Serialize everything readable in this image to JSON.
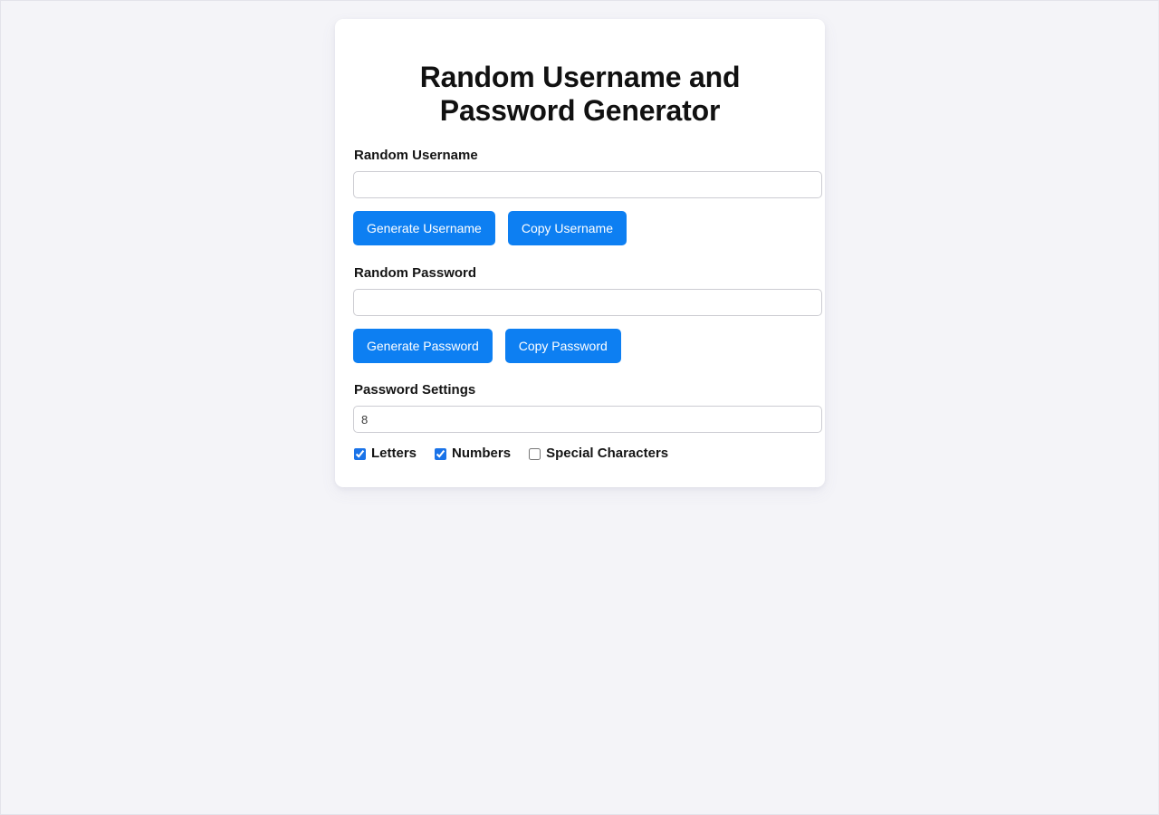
{
  "page": {
    "title": "Random Username and Password Generator",
    "background_color": "#f4f4f8",
    "accent_color": "#0d7ff2"
  },
  "username_section": {
    "label": "Random Username",
    "input": {
      "value": "",
      "placeholder": ""
    },
    "generate_button": "Generate Username",
    "copy_button": "Copy Username"
  },
  "password_section": {
    "label": "Random Password",
    "input": {
      "value": "",
      "placeholder": ""
    },
    "generate_button": "Generate Password",
    "copy_button": "Copy Password"
  },
  "settings_section": {
    "label": "Password Settings",
    "length_input": {
      "value": "8",
      "placeholder": ""
    },
    "options": [
      {
        "label": "Letters",
        "checked": true
      },
      {
        "label": "Numbers",
        "checked": true
      },
      {
        "label": "Special Characters",
        "checked": false
      }
    ]
  }
}
